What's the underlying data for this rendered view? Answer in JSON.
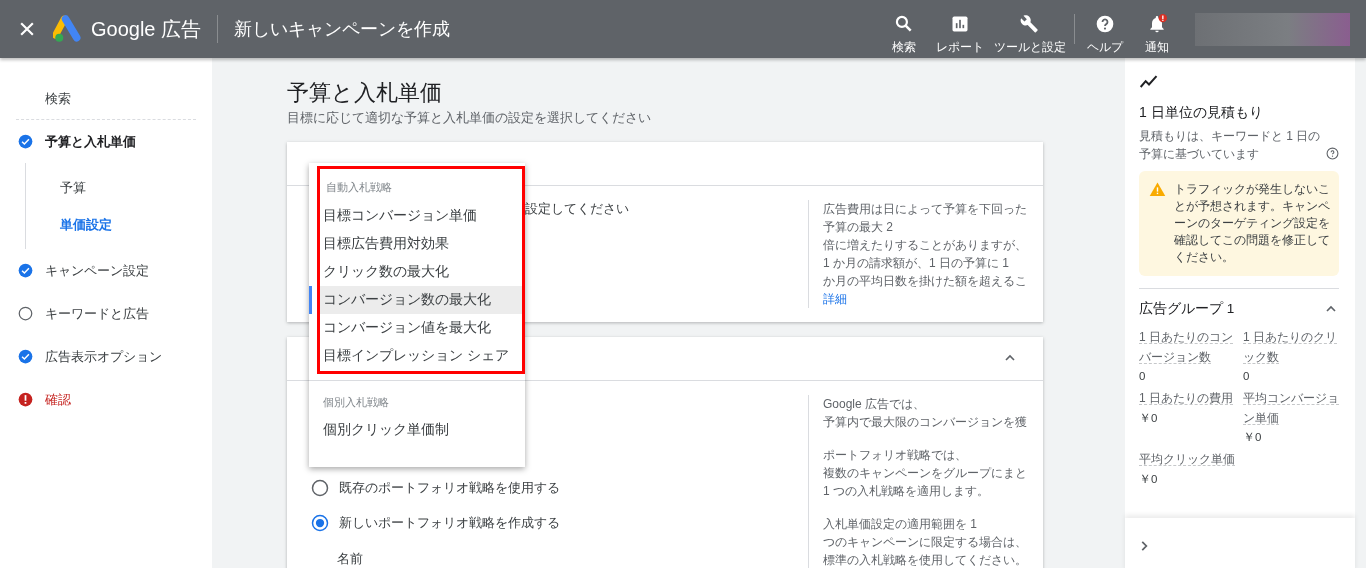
{
  "top_bar": {
    "brand": "Google 広告",
    "title": "新しいキャンペーンを作成",
    "actions": [
      {
        "label": "検索",
        "alert": false
      },
      {
        "label": "レポート",
        "alert": false
      },
      {
        "label": "ツールと設定",
        "alert": false
      },
      {
        "label": "ヘルプ",
        "alert": false
      },
      {
        "label": "通知",
        "alert": true
      }
    ]
  },
  "sidebar": {
    "items": [
      {
        "label": "検索",
        "kind": "link",
        "selected": false
      },
      {
        "label": "予算と入札単価",
        "kind": "step",
        "completed": true,
        "error": false,
        "selected": true,
        "children": [
          {
            "label": "予算",
            "selected": false
          },
          {
            "label": "単価設定",
            "selected": true
          }
        ]
      },
      {
        "label": "キャンペーン設定",
        "kind": "step",
        "completed": true,
        "error": false,
        "selected": false
      },
      {
        "label": "キーワードと広告",
        "kind": "step",
        "completed": false,
        "error": false,
        "selected": false
      },
      {
        "label": "広告表示オプション",
        "kind": "step",
        "completed": true,
        "error": false,
        "selected": false
      },
      {
        "label": "確認",
        "kind": "step",
        "error": true,
        "selected": false
      }
    ]
  },
  "page": {
    "title": "予算と入札単価",
    "subtitle": "目標に応じて適切な予算と入札単価の設定を選択してください"
  },
  "budget_card": {
    "body_text": "設定してください",
    "help_lines": [
      "広告費用は日によって予算を下回った",
      "予算の最大 2",
      "倍に増えたりすることがありますが、",
      "1 か月の請求額が、1 日の予算に 1",
      "か月の平均日数を掛けた額を超えるこ"
    ],
    "help_link": "詳細"
  },
  "bidding_card": {
    "expanded": true,
    "options": [
      {
        "label": "既存のポートフォリオ戦略を使用する",
        "selected": false
      },
      {
        "label": "新しいポートフォリオ戦略を作成する",
        "selected": true
      }
    ],
    "field_label": "名前",
    "help_paragraphs": [
      [
        "Google 広告では、",
        "予算内で最大限のコンバージョンを獲"
      ],
      [
        "ポートフォリオ戦略では、",
        "複数のキャンペーンをグループにまと",
        "1 つの入札戦略を適用します。"
      ],
      [
        "入札単価設定の適用範囲を 1",
        "つのキャンペーンに限定する場合は、",
        "標準の入札戦略を使用してください。"
      ]
    ]
  },
  "strategy_menu": {
    "groups": [
      {
        "heading": "自動入札戦略",
        "highlighted": true,
        "items": [
          {
            "label": "目標コンバージョン単価",
            "selected": false
          },
          {
            "label": "目標広告費用対効果",
            "selected": false
          },
          {
            "label": "クリック数の最大化",
            "selected": false
          },
          {
            "label": "コンバージョン数の最大化",
            "selected": true
          },
          {
            "label": "コンバージョン値を最大化",
            "selected": false
          },
          {
            "label": "目標インプレッション シェア",
            "selected": false
          }
        ]
      },
      {
        "heading": "個別入札戦略",
        "highlighted": false,
        "items": [
          {
            "label": "個別クリック単価制",
            "selected": false
          }
        ]
      }
    ]
  },
  "estimate_panel": {
    "title": "1 日単位の見積もり",
    "description": "見積もりは、キーワードと 1 日の予算に基づいています",
    "warning": "トラフィックが発生しないことが予想されます。キャンペーンのターゲティング設定を確認してこの問題を修正してください。",
    "ad_group": {
      "title": "広告グループ 1",
      "expanded": true,
      "metrics": [
        {
          "label": "1 日あたりのコンバージョン数",
          "value": "0"
        },
        {
          "label": "1 日あたりのクリック数",
          "value": "0"
        },
        {
          "label": "1 日あたりの費用",
          "value": "￥0"
        },
        {
          "label": "平均コンバージョン単価",
          "value": "￥0"
        },
        {
          "label": "平均クリック単価",
          "value": "￥0"
        }
      ]
    }
  }
}
